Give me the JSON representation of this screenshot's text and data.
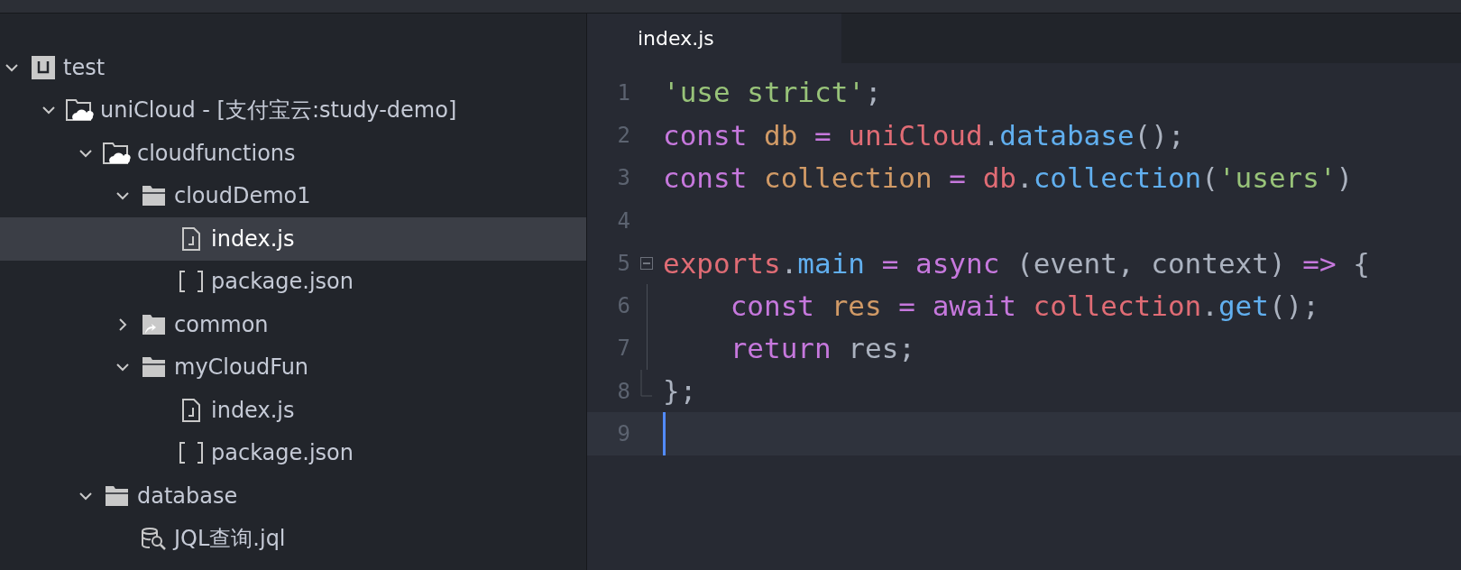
{
  "tree": [
    {
      "label": "test",
      "kind": "project",
      "expanded": true,
      "selected": false,
      "children": [
        {
          "label": "uniCloud - [支付宝云:study-demo]",
          "kind": "cloud-folder",
          "expanded": true,
          "selected": false,
          "children": [
            {
              "label": "cloudfunctions",
              "kind": "cloud-folder",
              "expanded": true,
              "selected": false,
              "children": [
                {
                  "label": "cloudDemo1",
                  "kind": "folder",
                  "expanded": true,
                  "selected": false,
                  "children": [
                    {
                      "label": "index.js",
                      "kind": "js-file",
                      "selected": true
                    },
                    {
                      "label": "package.json",
                      "kind": "json-file",
                      "selected": false
                    }
                  ]
                },
                {
                  "label": "common",
                  "kind": "link-folder",
                  "expanded": false,
                  "selected": false
                },
                {
                  "label": "myCloudFun",
                  "kind": "folder",
                  "expanded": true,
                  "selected": false,
                  "children": [
                    {
                      "label": "index.js",
                      "kind": "js-file",
                      "selected": false
                    },
                    {
                      "label": "package.json",
                      "kind": "json-file",
                      "selected": false
                    }
                  ]
                }
              ]
            },
            {
              "label": "database",
              "kind": "folder",
              "expanded": true,
              "selected": false,
              "children": [
                {
                  "label": "JQL查询.jql",
                  "kind": "db-file",
                  "selected": false
                }
              ]
            }
          ]
        }
      ]
    }
  ],
  "editor": {
    "tabs": [
      {
        "label": "index.js",
        "selected": true
      }
    ],
    "lines": [
      {
        "number": "1",
        "kind": "plain",
        "current": false,
        "tokens": [
          {
            "text": "'use strict'",
            "kind": "string"
          },
          {
            "text": ";",
            "kind": "plain"
          }
        ]
      },
      {
        "number": "2",
        "kind": "plain",
        "current": false,
        "tokens": [
          {
            "text": "const ",
            "kind": "keyword"
          },
          {
            "text": "db ",
            "kind": "variable"
          },
          {
            "text": "= ",
            "kind": "keyword"
          },
          {
            "text": "uniCloud",
            "kind": "object"
          },
          {
            "text": ".",
            "kind": "plain"
          },
          {
            "text": "database",
            "kind": "method"
          },
          {
            "text": "();",
            "kind": "plain"
          }
        ]
      },
      {
        "number": "3",
        "kind": "plain",
        "current": false,
        "tokens": [
          {
            "text": "const ",
            "kind": "keyword"
          },
          {
            "text": "collection ",
            "kind": "variable"
          },
          {
            "text": "= ",
            "kind": "keyword"
          },
          {
            "text": "db",
            "kind": "object"
          },
          {
            "text": ".",
            "kind": "plain"
          },
          {
            "text": "collection",
            "kind": "method"
          },
          {
            "text": "(",
            "kind": "plain"
          },
          {
            "text": "'users'",
            "kind": "string"
          },
          {
            "text": ")",
            "kind": "plain"
          }
        ]
      },
      {
        "number": "4",
        "kind": "plain",
        "current": false
      },
      {
        "number": "5",
        "kind": "fold-start",
        "current": false,
        "tokens": [
          {
            "text": "exports",
            "kind": "object"
          },
          {
            "text": ".",
            "kind": "plain"
          },
          {
            "text": "main ",
            "kind": "method"
          },
          {
            "text": "= ",
            "kind": "keyword"
          },
          {
            "text": "async ",
            "kind": "keyword"
          },
          {
            "text": "(event, context) ",
            "kind": "plain"
          },
          {
            "text": "=> ",
            "kind": "keyword"
          },
          {
            "text": "{",
            "kind": "plain"
          }
        ]
      },
      {
        "number": "6",
        "kind": "fold-body",
        "current": false,
        "tokens": [
          {
            "text": "    const ",
            "kind": "keyword"
          },
          {
            "text": "res ",
            "kind": "variable"
          },
          {
            "text": "= ",
            "kind": "keyword"
          },
          {
            "text": "await ",
            "kind": "keyword"
          },
          {
            "text": "collection",
            "kind": "object"
          },
          {
            "text": ".",
            "kind": "plain"
          },
          {
            "text": "get",
            "kind": "method"
          },
          {
            "text": "();",
            "kind": "plain"
          }
        ]
      },
      {
        "number": "7",
        "kind": "fold-body",
        "current": false,
        "tokens": [
          {
            "text": "    return ",
            "kind": "keyword"
          },
          {
            "text": "res;",
            "kind": "plain"
          }
        ]
      },
      {
        "number": "8",
        "kind": "fold-end",
        "current": false,
        "tokens": [
          {
            "text": "};",
            "kind": "plain"
          }
        ]
      },
      {
        "number": "9",
        "kind": "plain",
        "current": true
      }
    ]
  }
}
